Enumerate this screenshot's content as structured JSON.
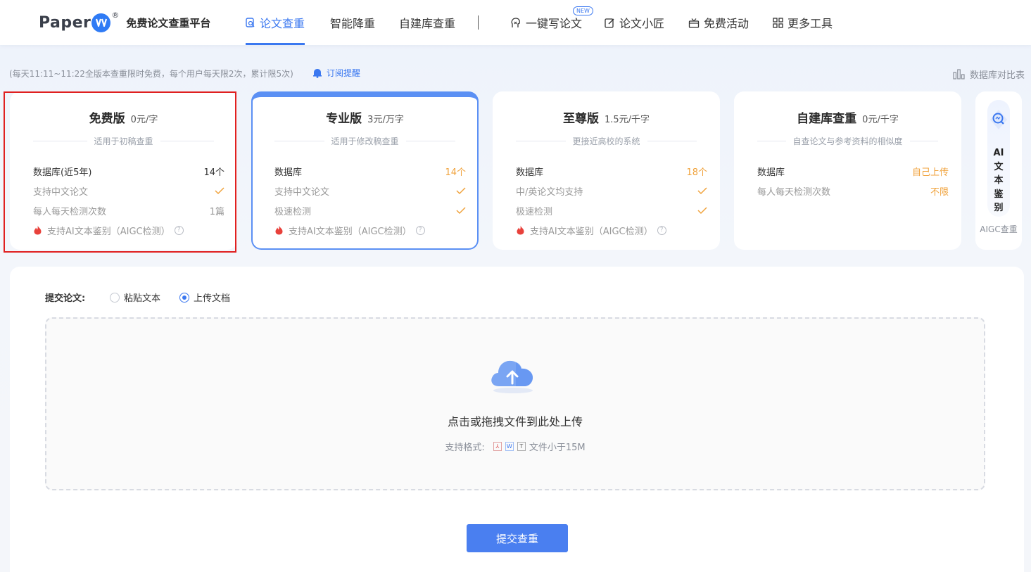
{
  "header": {
    "logo_text": "Paper",
    "logo_reg": "®",
    "logo_subtitle": "免费论文查重平台",
    "nav": [
      {
        "label": "论文查重",
        "icon": "search-doc-icon",
        "active": true
      },
      {
        "label": "智能降重",
        "active": false
      },
      {
        "label": "自建库查重",
        "active": false
      },
      {
        "label": "一键写论文",
        "icon": "pen-head-icon",
        "badge": "NEW",
        "active": false
      },
      {
        "label": "论文小匠",
        "icon": "edit-icon",
        "active": false
      },
      {
        "label": "免费活动",
        "icon": "gift-icon",
        "active": false
      },
      {
        "label": "更多工具",
        "icon": "grid-icon",
        "active": false
      }
    ]
  },
  "notice": {
    "text": "(每天11:11~11:22全版本查重限时免费，每个用户每天限2次，累计限5次)",
    "subscribe": "订阅提醒",
    "db_compare": "数据库对比表"
  },
  "plans": [
    {
      "name": "免费版",
      "price": "0元/字",
      "subtitle": "适用于初稿查重",
      "rows": [
        {
          "key": "数据库(近5年)",
          "value": "14个"
        },
        {
          "key": "支持中文论文",
          "value": "✓"
        },
        {
          "key": "每人每天检测次数",
          "value": "1篇"
        },
        {
          "key": "支持AI文本鉴别（AIGC检测）",
          "value": ""
        }
      ]
    },
    {
      "name": "专业版",
      "price": "3元/万字",
      "subtitle": "适用于修改稿查重",
      "rows": [
        {
          "key": "数据库",
          "value": "14个"
        },
        {
          "key": "支持中文论文",
          "value": "✓"
        },
        {
          "key": "极速检测",
          "value": "✓"
        },
        {
          "key": "支持AI文本鉴别（AIGC检测）",
          "value": ""
        }
      ]
    },
    {
      "name": "至尊版",
      "price": "1.5元/千字",
      "subtitle": "更接近高校的系统",
      "rows": [
        {
          "key": "数据库",
          "value": "18个"
        },
        {
          "key": "中/英论文均支持",
          "value": "✓"
        },
        {
          "key": "极速检测",
          "value": "✓"
        },
        {
          "key": "支持AI文本鉴别（AIGC检测）",
          "value": ""
        }
      ]
    },
    {
      "name": "自建库查重",
      "price": "0元/千字",
      "subtitle": "自查论文与参考资料的相似度",
      "rows": [
        {
          "key": "数据库",
          "value": "自己上传"
        },
        {
          "key": "每人每天检测次数",
          "value": "不限"
        }
      ]
    }
  ],
  "ai_card": {
    "chars": [
      "AI",
      "文",
      "本",
      "鉴",
      "别"
    ],
    "label": "AIGC查重"
  },
  "submit": {
    "label": "提交论文:",
    "options": [
      "粘贴文本",
      "上传文档"
    ],
    "selected": "上传文档",
    "drop_text": "点击或拖拽文件到此处上传",
    "formats_label": "支持格式:",
    "formats": [
      "PDF",
      "W",
      "T"
    ],
    "size_limit": "文件小于15M",
    "button": "提交查重"
  },
  "colors": {
    "accent": "#3b78f0",
    "orange": "#f0a23b",
    "fire": "#e8413b",
    "highlight": "#e02020"
  }
}
